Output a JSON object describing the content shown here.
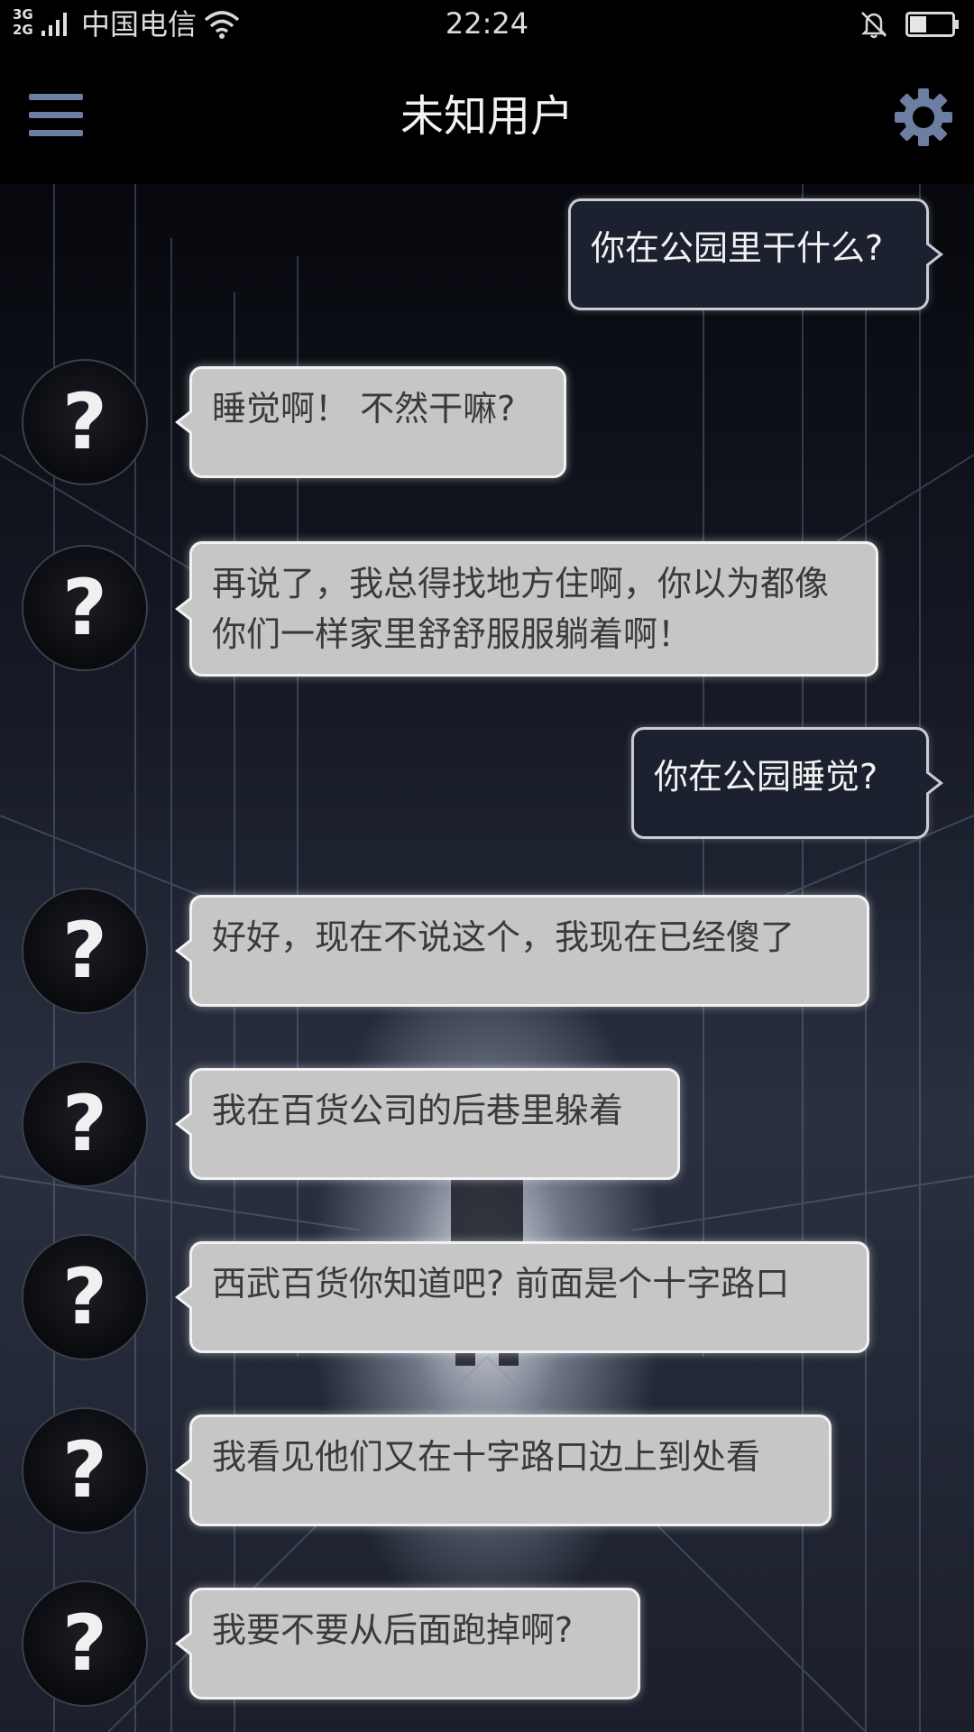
{
  "status_bar": {
    "network_type_top": "3G",
    "network_type_bottom": "2G",
    "carrier": "中国电信",
    "time": "22:24",
    "battery_level": 0.4,
    "icons": [
      "signal-icon",
      "wifi-icon",
      "bell-muted-icon",
      "battery-icon"
    ]
  },
  "header": {
    "title": "未知用户",
    "menu_icon": "hamburger-menu-icon",
    "settings_icon": "gear-icon"
  },
  "chat": {
    "avatar_symbol": "?",
    "messages": [
      {
        "sender": "me",
        "text": "你在公园里干什么?"
      },
      {
        "sender": "other",
        "text": "睡觉啊！ 不然干嘛?"
      },
      {
        "sender": "other",
        "text": "再说了，我总得找地方住啊，你以为都像你们一样家里舒舒服服躺着啊！"
      },
      {
        "sender": "me",
        "text": "你在公园睡觉?"
      },
      {
        "sender": "other",
        "text": "好好，现在不说这个，我现在已经傻了"
      },
      {
        "sender": "other",
        "text": "我在百货公司的后巷里躲着"
      },
      {
        "sender": "other",
        "text": "西武百货你知道吧? 前面是个十字路口"
      },
      {
        "sender": "other",
        "text": "我看见他们又在十字路口边上到处看"
      },
      {
        "sender": "other",
        "text": "我要不要从后面跑掉啊?"
      }
    ]
  },
  "colors": {
    "header_bg": "#000000",
    "icon_accent": "#6c7fa3",
    "incoming_bubble": "#c6c6c6",
    "outgoing_bubble": "#1c2130"
  }
}
